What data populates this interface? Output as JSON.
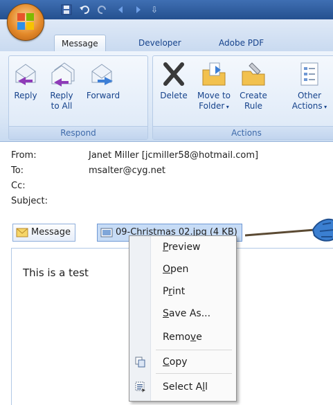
{
  "ribbon_tabs": [
    "Message",
    "Developer",
    "Adobe PDF"
  ],
  "groups": {
    "respond": {
      "label": "Respond",
      "buttons": [
        {
          "label1": "Reply",
          "label2": ""
        },
        {
          "label1": "Reply",
          "label2": "to All"
        },
        {
          "label1": "Forward",
          "label2": ""
        }
      ]
    },
    "actions": {
      "label": "Actions",
      "buttons": [
        {
          "label1": "Delete",
          "label2": ""
        },
        {
          "label1": "Move to",
          "label2": "Folder"
        },
        {
          "label1": "Create",
          "label2": "Rule"
        },
        {
          "label1": "Other",
          "label2": "Actions"
        }
      ]
    }
  },
  "headers": {
    "from_label": "From:",
    "from_value": "Janet Miller [jcmiller58@hotmail.com]",
    "to_label": "To:",
    "to_value": "msalter@cyg.net",
    "cc_label": "Cc:",
    "cc_value": "",
    "subject_label": "Subject:",
    "subject_value": ""
  },
  "attachments": {
    "message_label": "Message",
    "file_label": "09-Christmas 02.jpg (4 KB)"
  },
  "body_text": "This is a test",
  "context_menu": {
    "preview": {
      "pre": "",
      "key": "P",
      "post": "review"
    },
    "open": {
      "pre": "",
      "key": "O",
      "post": "pen"
    },
    "print": {
      "pre": "P",
      "key": "r",
      "post": "int"
    },
    "save_as": {
      "pre": "",
      "key": "S",
      "post": "ave As..."
    },
    "remove": {
      "pre": "Remo",
      "key": "v",
      "post": "e"
    },
    "copy": {
      "pre": "",
      "key": "C",
      "post": "opy"
    },
    "select_all": {
      "pre": "Select A",
      "key": "l",
      "post": "l"
    }
  },
  "colors": {
    "title_bar": "#24508f",
    "ribbon_text": "#15428b",
    "selected_attachment": "#c7dcf6"
  }
}
